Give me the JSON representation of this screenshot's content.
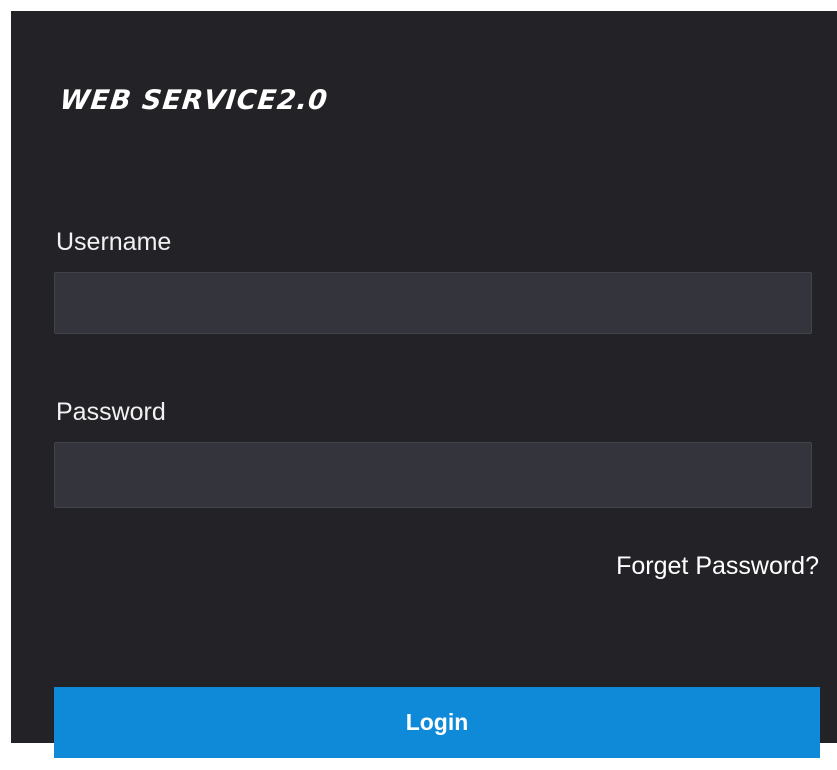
{
  "brand": {
    "title": "WEB SERVICE2.0"
  },
  "form": {
    "username_label": "Username",
    "username_value": "",
    "password_label": "Password",
    "password_value": "",
    "forget_password": "Forget Password?",
    "login_label": "Login"
  },
  "colors": {
    "panel_background": "#232227",
    "input_background": "#34343d",
    "accent": "#0f8ad9",
    "text": "#ffffff"
  }
}
